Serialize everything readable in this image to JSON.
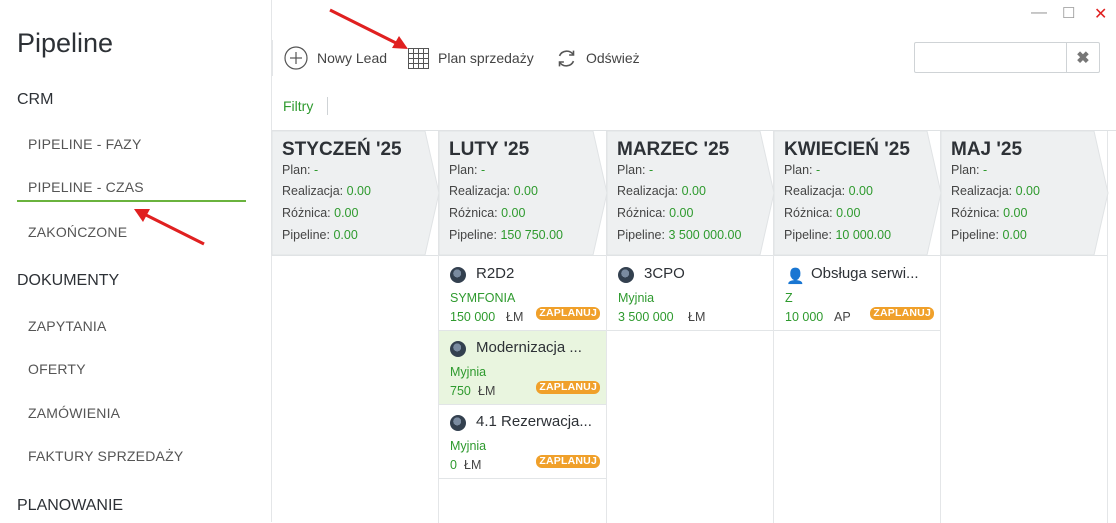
{
  "app_title": "Pipeline",
  "sidebar": {
    "sections": [
      {
        "label": "CRM",
        "items": [
          {
            "label": "PIPELINE - FAZY"
          },
          {
            "label": "PIPELINE - CZAS",
            "active": true
          },
          {
            "label": "ZAKOŃCZONE"
          }
        ]
      },
      {
        "label": "DOKUMENTY",
        "items": [
          {
            "label": "ZAPYTANIA"
          },
          {
            "label": "OFERTY"
          },
          {
            "label": "ZAMÓWIENIA"
          },
          {
            "label": "FAKTURY SPRZEDAŻY"
          }
        ]
      },
      {
        "label": "PLANOWANIE",
        "items": []
      }
    ]
  },
  "window_controls": {
    "minimize": "—",
    "maximize": "☐",
    "close": "✕"
  },
  "toolbar": {
    "new_lead": "Nowy Lead",
    "sales_plan": "Plan sprzedaży",
    "refresh": "Odśwież"
  },
  "search": {
    "value": "",
    "placeholder": "",
    "clear": "✖"
  },
  "filters_label": "Filtry",
  "columns": [
    {
      "title": "STYCZEŃ '25",
      "plan_label": "Plan:",
      "plan": "-",
      "real_label": "Realizacja:",
      "real": "0.00",
      "diff_label": "Różnica:",
      "diff": "0.00",
      "pipe_label": "Pipeline:",
      "pipe": "0.00",
      "cards": []
    },
    {
      "title": "LUTY '25",
      "plan_label": "Plan:",
      "plan": "-",
      "real_label": "Realizacja:",
      "real": "0.00",
      "diff_label": "Różnica:",
      "diff": "0.00",
      "pipe_label": "Pipeline:",
      "pipe": "150 750.00",
      "cards": [
        {
          "title": "R2D2",
          "client": "SYMFONIA",
          "amount": "150 000",
          "currency": "ŁM",
          "badge": "ZAPLANUJ",
          "icon": "avatar-icon"
        },
        {
          "title": "Modernizacja ...",
          "client": "Myjnia",
          "amount": "750",
          "currency": "ŁM",
          "badge": "ZAPLANUJ",
          "icon": "avatar-icon",
          "selected": true
        },
        {
          "title": "4.1 Rezerwacja...",
          "client": "Myjnia",
          "amount": "0",
          "currency": "ŁM",
          "badge": "ZAPLANUJ",
          "icon": "avatar-icon"
        }
      ]
    },
    {
      "title": "MARZEC '25",
      "plan_label": "Plan:",
      "plan": "-",
      "real_label": "Realizacja:",
      "real": "0.00",
      "diff_label": "Różnica:",
      "diff": "0.00",
      "pipe_label": "Pipeline:",
      "pipe": "3 500 000.00",
      "cards": [
        {
          "title": "3CPO",
          "client": "Myjnia",
          "amount": "3 500 000",
          "currency": "ŁM",
          "badge": "",
          "icon": "avatar-icon"
        }
      ]
    },
    {
      "title": "KWIECIEŃ '25",
      "plan_label": "Plan:",
      "plan": "-",
      "real_label": "Realizacja:",
      "real": "0.00",
      "diff_label": "Różnica:",
      "diff": "0.00",
      "pipe_label": "Pipeline:",
      "pipe": "10 000.00",
      "cards": [
        {
          "title": "Obsługa serwi...",
          "client": "Z",
          "amount": "10 000",
          "currency": "AP",
          "badge": "ZAPLANUJ",
          "icon": "person-icon"
        }
      ]
    },
    {
      "title": "MAJ '25",
      "plan_label": "Plan:",
      "plan": "-",
      "real_label": "Realizacja:",
      "real": "0.00",
      "diff_label": "Różnica:",
      "diff": "0.00",
      "pipe_label": "Pipeline:",
      "pipe": "0.00",
      "cards": []
    }
  ],
  "colors": {
    "accent": "#6ab33e",
    "value_green": "#2e9a2e",
    "badge": "#f0a02a",
    "annotation_arrow": "#e02020"
  }
}
